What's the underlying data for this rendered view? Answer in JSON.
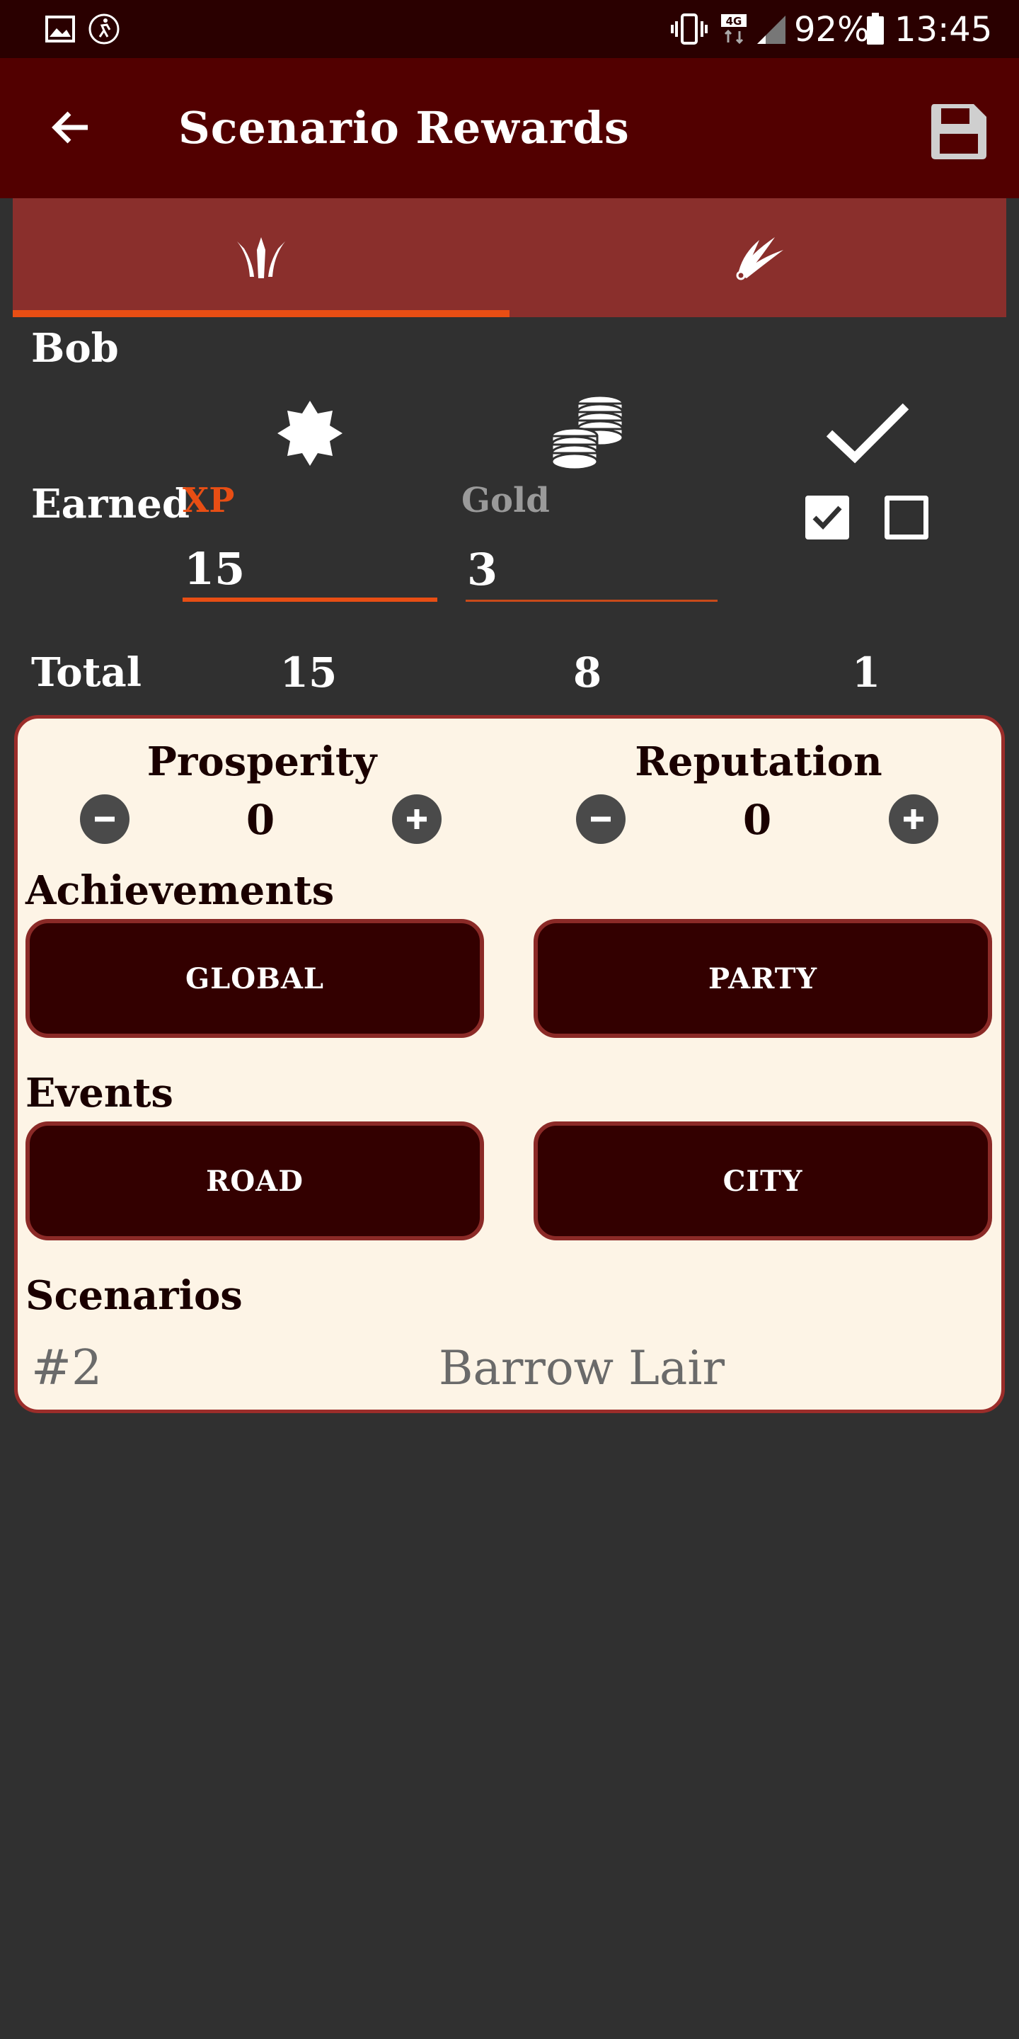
{
  "status_bar": {
    "battery": "92%",
    "time": "13:45",
    "network": "4G",
    "icons": [
      "image-icon",
      "activity-icon",
      "vibrate-icon",
      "network-4g-icon",
      "signal-icon",
      "battery-icon"
    ]
  },
  "app_bar": {
    "title": "Scenario Rewards",
    "back_icon": "arrow-left-icon",
    "save_icon": "floppy-disk-icon"
  },
  "tabs": [
    {
      "icon": "character-class-icon",
      "selected": true
    },
    {
      "icon": "character-class-alt-icon",
      "selected": false
    }
  ],
  "player": {
    "name": "Bob",
    "earned_label": "Earned",
    "xp": {
      "label": "XP",
      "value": "15",
      "icon": "star-burst-icon"
    },
    "gold": {
      "label": "Gold",
      "value": "3",
      "icon": "coins-icon"
    },
    "check_icon": "checkmark-icon",
    "checkboxes": [
      true,
      false
    ],
    "total": {
      "label": "Total",
      "xp": "15",
      "gold": "8",
      "checks": "1"
    }
  },
  "card": {
    "prosperity": {
      "label": "Prosperity",
      "value": "0"
    },
    "reputation": {
      "label": "Reputation",
      "value": "0"
    },
    "achievements": {
      "label": "Achievements",
      "buttons": [
        "GLOBAL",
        "PARTY"
      ]
    },
    "events": {
      "label": "Events",
      "buttons": [
        "ROAD",
        "CITY"
      ]
    },
    "scenarios": {
      "label": "Scenarios",
      "number": "#2",
      "name": "Barrow Lair"
    }
  },
  "colors": {
    "background": "#303030",
    "status_bar": "#2a0000",
    "app_bar": "#520000",
    "tab_bar": "#8a2f2c",
    "accent": "#e84e14",
    "card": "#fdf4e6",
    "card_border": "#9b2d2a",
    "button_fill": "#330000"
  }
}
